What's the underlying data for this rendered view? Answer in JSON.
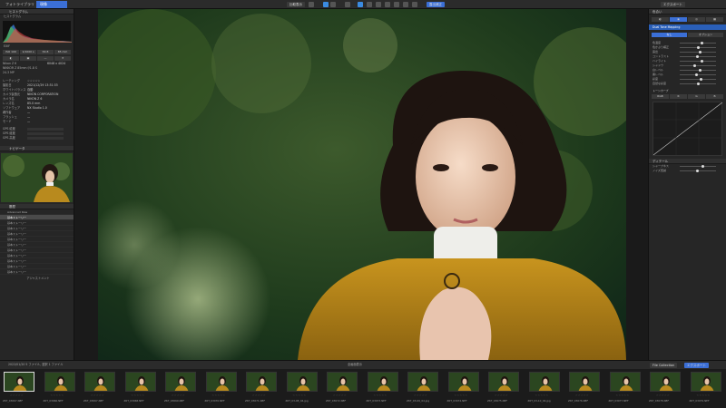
{
  "app": {
    "tabs": [
      "フォトライブラリ",
      "現像"
    ],
    "active_tab": "現像",
    "center_label": "比較表示",
    "right_buttons": [
      "露出補正",
      "エクスポート"
    ]
  },
  "left": {
    "histogram_title": "ヒストグラム",
    "histogram_sub": "ヒストグラム",
    "exif_title": "EXIF",
    "info_buttons": [
      "ISO 100",
      "1/1000 s",
      "f/2.8",
      "85 mm"
    ],
    "camera_rows": [
      {
        "k": "Nikon Z 6",
        "v": "6048 x 4024"
      },
      {
        "k": "NIKKOR Z 85mm f/1.8 S",
        "v": ""
      },
      {
        "k": "24.3 MP",
        "v": ""
      }
    ],
    "meta_rows": [
      {
        "k": "レーティング",
        "v": "☆☆☆☆☆"
      },
      {
        "k": "撮影日",
        "v": "2021/12/29 13:31:33"
      },
      {
        "k": "ホワイトバランス",
        "v": "自動"
      },
      {
        "k": "カメラ製造元",
        "v": "NIKON CORPORATION"
      },
      {
        "k": "カメラ名",
        "v": "NIKON Z 6"
      },
      {
        "k": "レンズ名",
        "v": "85.0 mm"
      },
      {
        "k": "ソフトウェア",
        "v": "NX Studio 1.0"
      },
      {
        "k": "著作者",
        "v": "—"
      },
      {
        "k": "フラッシュ",
        "v": "—"
      },
      {
        "k": "モード",
        "v": "—"
      }
    ],
    "gps_rows": [
      "GPS 緯度",
      "GPS 経度",
      "GPS 高度"
    ],
    "navigator_title": "ナビゲータ",
    "history_title": "履歴",
    "history_items": [
      "Advanced Raw",
      "基本ストーリー",
      "基本ストーリー",
      "基本ストーリー",
      "基本ストーリー",
      "基本ストーリー",
      "基本ストーリー",
      "基本ストーリー",
      "基本ストーリー",
      "基本ストーリー",
      "基本ストーリー",
      "基本ストーリー"
    ],
    "history_selected": 1,
    "footer_label": "アジャストメント"
  },
  "right": {
    "section_title": "色合い",
    "preset_label": "Dual Tone Mapping",
    "options": [
      "なし",
      "オプション"
    ],
    "rows": [
      "色温度",
      "色かぶり補正",
      "露出",
      "コントラスト",
      "ハイライト",
      "シャドウ",
      "白レベル",
      "黒レベル",
      "彩度",
      "自然な彩度"
    ],
    "slider_levels": [
      0.62,
      0.5,
      0.55,
      0.48,
      0.6,
      0.42,
      0.55,
      0.45,
      0.58,
      0.5
    ],
    "curve_title": "トーンカーブ",
    "channel_labels": [
      "RGB",
      "R",
      "G",
      "B"
    ],
    "bottom_title": "ディテール",
    "bottom_rows": [
      "シャープネス",
      "ノイズ低減"
    ]
  },
  "filmbar": {
    "left_label": "2022/01/20 5 ファイル, 選択 1 ファイル",
    "center_label": "全画面表示",
    "collection_label": "File Collection",
    "export_label": "エクスポート"
  },
  "filmstrip": [
    {
      "label": "Z6T_03067.NEF"
    },
    {
      "label": "Z6T_03066.NEF"
    },
    {
      "label": "Z6T_03067.NEF"
    },
    {
      "label": "Z6T_03068.NEF"
    },
    {
      "label": "Z6T_03069.NEF"
    },
    {
      "label": "Z6T_03070.NEF"
    },
    {
      "label": "Z6T_03071.NEF"
    },
    {
      "label": "Z6T_03-08_04.jpg"
    },
    {
      "label": "Z6T_03072.NEF"
    },
    {
      "label": "Z6T_03073.NEF"
    },
    {
      "label": "Z6T_03-09_04.jpg"
    },
    {
      "label": "Z6T_03074.NEF"
    },
    {
      "label": "Z6T_03075.NEF"
    },
    {
      "label": "Z6T_03-10_04.jpg"
    },
    {
      "label": "Z6T_03076.NEF"
    },
    {
      "label": "Z6T_03077.NEF"
    },
    {
      "label": "Z6T_03078.NEF"
    },
    {
      "label": "Z6T_03079.NEF"
    }
  ],
  "filmstrip_selected": 0
}
